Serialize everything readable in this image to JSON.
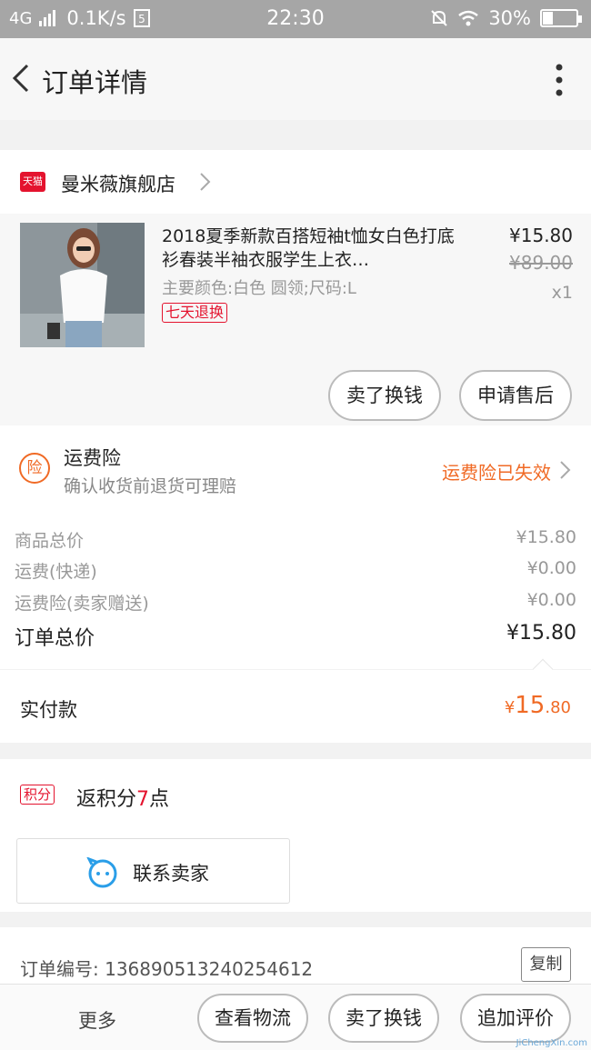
{
  "status_bar": {
    "network": "4G",
    "speed": "0.1K/s",
    "time": "22:30",
    "battery": "30%",
    "battery_level": 0.3
  },
  "nav": {
    "title": "订单详情"
  },
  "shop": {
    "badge": "天猫",
    "name": "曼米薇旗舰店"
  },
  "item": {
    "title": "2018夏季新款百搭短袖t恤女白色打底衫春装半袖衣服学生上衣…",
    "spec": "主要颜色:白色 圆领;尺码:L",
    "badge": "七天退换",
    "price": "¥15.80",
    "original_price": "¥89.00",
    "quantity": "x1",
    "btn_resell": "卖了换钱",
    "btn_aftersale": "申请售后"
  },
  "insurance": {
    "icon_text": "险",
    "title": "运费险",
    "subtitle": "确认收货前退货可理赔",
    "status": "运费险已失效"
  },
  "summary": {
    "rows": [
      {
        "label": "商品总价",
        "value": "¥15.80"
      },
      {
        "label": "运费(快递)",
        "value": "¥0.00"
      },
      {
        "label": "运费险(卖家赠送)",
        "value": "¥0.00"
      }
    ],
    "total_label": "订单总价",
    "total_value": "¥15.80"
  },
  "payment": {
    "label": "实付款",
    "currency": "¥",
    "amount_int": "15",
    "amount_dec": ".80"
  },
  "points": {
    "badge": "积分",
    "prefix": "返积分",
    "count": "7",
    "suffix": "点",
    "contact_label": "联系卖家"
  },
  "order": {
    "number_label": "订单编号: 136890513240254612",
    "copy_label": "复制"
  },
  "bottom_bar": {
    "more": "更多",
    "logistics": "查看物流",
    "resell": "卖了换钱",
    "review": "追加评价"
  },
  "watermark": {
    "text": "JiChengXin.com"
  }
}
